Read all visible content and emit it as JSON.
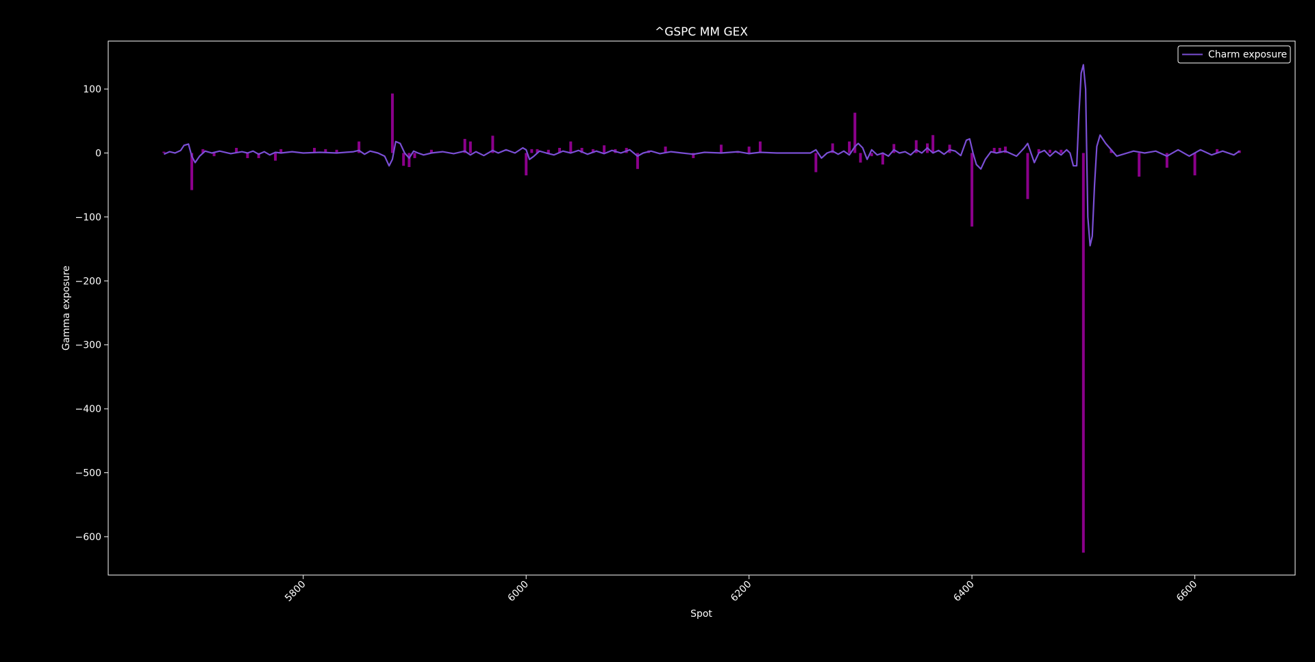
{
  "chart_data": {
    "type": "bar",
    "title": "^GSPC MM GEX",
    "xlabel": "Spot",
    "ylabel": "Gamma exposure",
    "xlim": [
      5625,
      6690
    ],
    "ylim": [
      -660,
      175
    ],
    "xticks": [
      5800,
      6000,
      6200,
      6400,
      6600
    ],
    "xtick_labels": [
      "5800",
      "6000",
      "6200",
      "6400",
      "6600"
    ],
    "yticks": [
      100,
      0,
      -100,
      -200,
      -300,
      -400,
      -500,
      -600
    ],
    "ytick_labels": [
      "100",
      "0",
      "−100",
      "−200",
      "−300",
      "−400",
      "−500",
      "−600"
    ],
    "grid": false,
    "legend": {
      "location": "top-right",
      "entries": [
        "Charm exposure"
      ]
    },
    "colors": {
      "bars": "#8b008b",
      "line": "#7b4fd6",
      "background": "#000000",
      "axes": "#ffffff"
    },
    "bars_series": {
      "name": "",
      "x": [
        5675,
        5700,
        5710,
        5720,
        5740,
        5750,
        5760,
        5775,
        5780,
        5810,
        5820,
        5830,
        5850,
        5880,
        5890,
        5895,
        5900,
        5915,
        5945,
        5950,
        5970,
        6000,
        6005,
        6010,
        6020,
        6030,
        6040,
        6050,
        6060,
        6070,
        6080,
        6090,
        6100,
        6110,
        6125,
        6150,
        6175,
        6190,
        6200,
        6210,
        6260,
        6275,
        6290,
        6295,
        6300,
        6310,
        6320,
        6330,
        6350,
        6360,
        6365,
        6380,
        6400,
        6420,
        6425,
        6430,
        6450,
        6460,
        6470,
        6480,
        6500,
        6525,
        6550,
        6575,
        6600,
        6620,
        6640
      ],
      "values": [
        2,
        -58,
        6,
        -5,
        8,
        -8,
        -8,
        -12,
        6,
        8,
        6,
        5,
        18,
        93,
        -20,
        -22,
        -8,
        5,
        22,
        18,
        27,
        -35,
        6,
        6,
        5,
        8,
        18,
        8,
        6,
        12,
        6,
        8,
        -25,
        4,
        10,
        -8,
        13,
        3,
        10,
        18,
        -30,
        15,
        18,
        63,
        -15,
        -5,
        -18,
        14,
        20,
        15,
        28,
        13,
        -115,
        8,
        8,
        10,
        -72,
        6,
        5,
        5,
        -625,
        5,
        -37,
        -23,
        -35,
        6,
        4
      ]
    },
    "line_series": {
      "name": "Charm exposure",
      "x": [
        5675,
        5680,
        5685,
        5690,
        5693,
        5697,
        5700,
        5703,
        5707,
        5712,
        5718,
        5725,
        5735,
        5745,
        5750,
        5755,
        5760,
        5765,
        5770,
        5775,
        5780,
        5790,
        5800,
        5815,
        5830,
        5845,
        5850,
        5855,
        5860,
        5867,
        5873,
        5877,
        5880,
        5883,
        5887,
        5891,
        5895,
        5899,
        5903,
        5908,
        5915,
        5925,
        5935,
        5945,
        5950,
        5955,
        5962,
        5970,
        5975,
        5982,
        5990,
        5997,
        6000,
        6003,
        6007,
        6012,
        6018,
        6025,
        6033,
        6040,
        6047,
        6055,
        6063,
        6070,
        6077,
        6085,
        6093,
        6100,
        6105,
        6112,
        6120,
        6130,
        6140,
        6150,
        6160,
        6175,
        6190,
        6200,
        6210,
        6225,
        6245,
        6255,
        6260,
        6265,
        6270,
        6275,
        6280,
        6285,
        6290,
        6295,
        6298,
        6302,
        6306,
        6310,
        6315,
        6320,
        6325,
        6330,
        6335,
        6340,
        6345,
        6350,
        6355,
        6360,
        6365,
        6370,
        6375,
        6380,
        6385,
        6390,
        6395,
        6398,
        6401,
        6404,
        6408,
        6412,
        6417,
        6422,
        6430,
        6440,
        6447,
        6450,
        6453,
        6456,
        6460,
        6465,
        6470,
        6475,
        6480,
        6485,
        6488,
        6491,
        6494,
        6496,
        6498,
        6500,
        6502,
        6504,
        6506,
        6508,
        6510,
        6512,
        6515,
        6520,
        6530,
        6545,
        6555,
        6565,
        6575,
        6585,
        6595,
        6605,
        6615,
        6625,
        6635,
        6640
      ],
      "values": [
        -2,
        2,
        0,
        4,
        12,
        14,
        -5,
        -15,
        -5,
        3,
        0,
        3,
        -1,
        2,
        0,
        3,
        -2,
        2,
        -3,
        1,
        0,
        2,
        0,
        1,
        0,
        2,
        4,
        -2,
        3,
        0,
        -5,
        -20,
        -10,
        18,
        15,
        0,
        -8,
        3,
        0,
        -3,
        0,
        2,
        -1,
        3,
        -3,
        2,
        -4,
        4,
        0,
        5,
        0,
        8,
        5,
        -10,
        -5,
        3,
        0,
        -3,
        3,
        0,
        4,
        -2,
        3,
        -1,
        4,
        0,
        5,
        -5,
        0,
        3,
        -1,
        2,
        0,
        -2,
        1,
        0,
        2,
        -1,
        1,
        0,
        0,
        0,
        5,
        -8,
        0,
        3,
        -2,
        3,
        -3,
        10,
        15,
        8,
        -10,
        5,
        -3,
        0,
        -5,
        5,
        0,
        2,
        -3,
        5,
        0,
        8,
        0,
        4,
        -2,
        5,
        3,
        -4,
        20,
        22,
        0,
        -18,
        -25,
        -10,
        2,
        0,
        3,
        -5,
        8,
        15,
        0,
        -15,
        0,
        4,
        -5,
        3,
        -3,
        5,
        0,
        -20,
        -20,
        60,
        125,
        138,
        100,
        -100,
        -145,
        -130,
        -50,
        10,
        28,
        15,
        -5,
        3,
        0,
        3,
        -5,
        5,
        -5,
        5,
        -3,
        3,
        -3,
        3,
        0,
        2
      ]
    }
  }
}
